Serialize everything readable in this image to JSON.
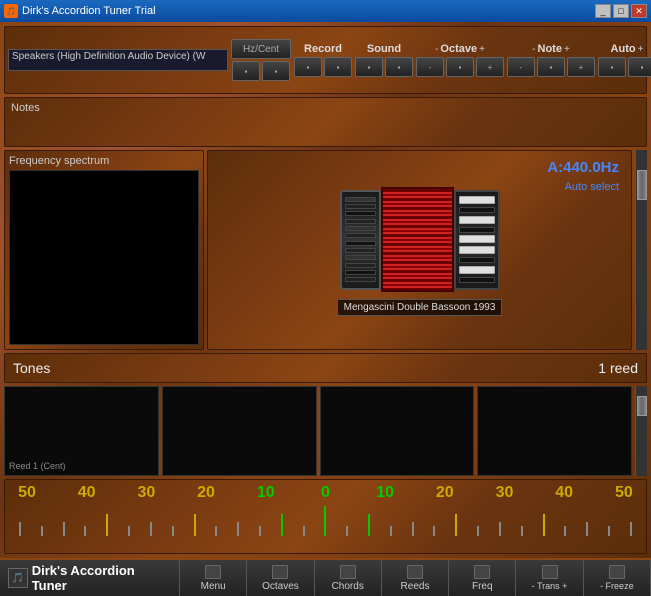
{
  "titlebar": {
    "title": "Dirk's Accordion Tuner Trial",
    "icon": "🎵",
    "controls": [
      "minimize",
      "maximize",
      "close"
    ]
  },
  "toolbar": {
    "device": "Speakers (High Definition Audio Device) (W",
    "hz_cent": "Hz/Cent",
    "record": "Record",
    "sound": "Sound",
    "octave_minus": "-",
    "octave_label": "Octave",
    "octave_plus": "+",
    "note_minus": "-",
    "note_label": "Note",
    "note_plus": "+",
    "auto_label": "Auto",
    "auto_plus": "+"
  },
  "notes": {
    "label": "Notes"
  },
  "frequency": {
    "label": "Frequency spectrum"
  },
  "accordion": {
    "name": "Mengascini Double Bassoon 1993",
    "auto_select": "Auto select",
    "hz_display": "A:440.0Hz"
  },
  "tones": {
    "label": "Tones",
    "reed_count": "1 reed"
  },
  "reed_panels": [
    {
      "label": "Reed 1 (Cent)"
    },
    {
      "label": ""
    },
    {
      "label": ""
    },
    {
      "label": ""
    }
  ],
  "meter": {
    "numbers": [
      {
        "value": "50",
        "color": "yellow"
      },
      {
        "value": "40",
        "color": "yellow"
      },
      {
        "value": "30",
        "color": "yellow"
      },
      {
        "value": "20",
        "color": "yellow"
      },
      {
        "value": "10",
        "color": "green"
      },
      {
        "value": "0",
        "color": "green"
      },
      {
        "value": "10",
        "color": "green"
      },
      {
        "value": "20",
        "color": "yellow"
      },
      {
        "value": "30",
        "color": "yellow"
      },
      {
        "value": "40",
        "color": "yellow"
      },
      {
        "value": "50",
        "color": "yellow"
      }
    ]
  },
  "bottom": {
    "logo_text": "Dirk's Accordion Tuner",
    "menu_label": "Menu",
    "octaves_label": "Octaves",
    "chords_label": "Chords",
    "reeds_label": "Reeds",
    "freq_label": "Freq",
    "trans_minus": "-",
    "trans_label": "Trans",
    "trans_plus": "+",
    "freeze_minus": "-",
    "freeze_label": "Freeze",
    "freeze_plus": "+"
  }
}
